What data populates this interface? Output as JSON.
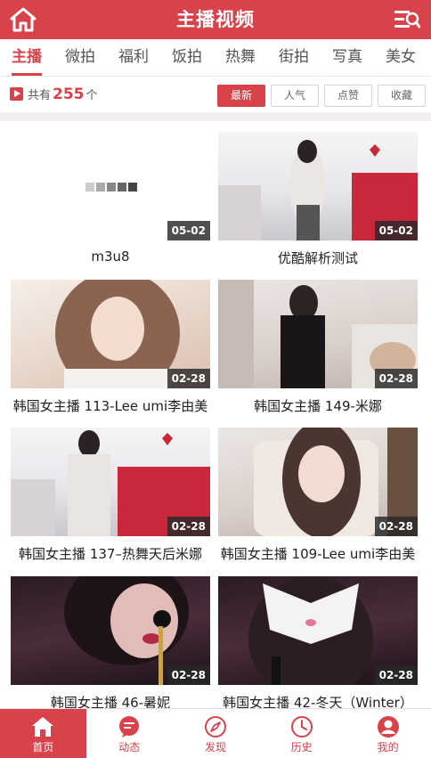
{
  "header": {
    "title": "主播视频",
    "home_icon": "home-icon",
    "menu_icon": "search-menu-icon",
    "bg": "#d9424a"
  },
  "tabs": [
    {
      "label": "主播",
      "active": true
    },
    {
      "label": "微拍"
    },
    {
      "label": "福利"
    },
    {
      "label": "饭拍"
    },
    {
      "label": "热舞"
    },
    {
      "label": "街拍"
    },
    {
      "label": "写真"
    },
    {
      "label": "美女"
    }
  ],
  "filter": {
    "prefix": "共有",
    "count": "255",
    "suffix": "个",
    "sort": [
      {
        "label": "最新",
        "active": true
      },
      {
        "label": "人气"
      },
      {
        "label": "点赞"
      },
      {
        "label": "收藏"
      }
    ]
  },
  "videos": [
    {
      "title": "m3u8",
      "date": "05-02",
      "thumb": "loading"
    },
    {
      "title": "优酷解析测试",
      "date": "05-02",
      "thumb": "room"
    },
    {
      "title": "韩国女主播 113-Lee umi李由美",
      "date": "02-28",
      "thumb": "warm"
    },
    {
      "title": "韩国女主播 149-米娜",
      "date": "02-28",
      "thumb": "dark"
    },
    {
      "title": "韩国女主播 137–热舞天后米娜",
      "date": "02-28",
      "thumb": "room"
    },
    {
      "title": "韩国女主播 109-Lee umi李由美",
      "date": "02-28",
      "thumb": "soft"
    },
    {
      "title": "韩国女主播 46-暑妮",
      "date": "02-28",
      "thumb": "night"
    },
    {
      "title": "韩国女主播 42-冬天（Winter）",
      "date": "02-28",
      "thumb": "night"
    }
  ],
  "tabbar": [
    {
      "label": "首页",
      "icon": "home-icon",
      "active": true
    },
    {
      "label": "动态",
      "icon": "chat-icon"
    },
    {
      "label": "发现",
      "icon": "compass-icon"
    },
    {
      "label": "历史",
      "icon": "clock-icon"
    },
    {
      "label": "我的",
      "icon": "user-icon"
    }
  ]
}
